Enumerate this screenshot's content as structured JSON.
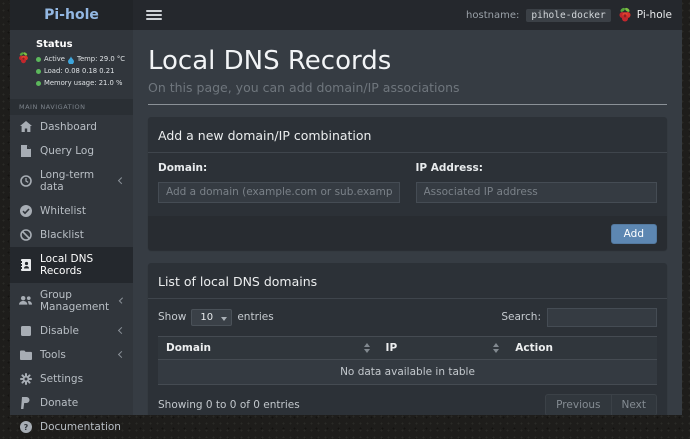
{
  "colors": {
    "brand_text": "#93b8e3",
    "status_green": "#5cb85c",
    "add_button": "#5d87b2",
    "content_bg": "#363c43",
    "card_bg": "#2c3137",
    "sidebar_bg": "#31363c"
  },
  "header": {
    "brand": "Pi-hole",
    "hostname_label": "hostname:",
    "hostname_value": "pihole-docker",
    "account_label": "Pi-hole"
  },
  "sidebar": {
    "status": {
      "title": "Status",
      "active_label": "Active",
      "temp": "Temp: 29.0 °C",
      "load": "Load: 0.08 0.18 0.21",
      "memory": "Memory usage: 21.0 %"
    },
    "nav_header": "MAIN NAVIGATION",
    "items": [
      {
        "label": "Dashboard"
      },
      {
        "label": "Query Log"
      },
      {
        "label": "Long-term data",
        "submenu": true
      },
      {
        "label": "Whitelist"
      },
      {
        "label": "Blacklist"
      },
      {
        "label": "Local DNS Records",
        "active": true
      },
      {
        "label": "Group Management",
        "submenu": true
      },
      {
        "label": "Disable",
        "submenu": true
      },
      {
        "label": "Tools",
        "submenu": true
      },
      {
        "label": "Settings"
      },
      {
        "label": "Donate"
      },
      {
        "label": "Documentation"
      }
    ]
  },
  "page": {
    "title": "Local DNS Records",
    "subtitle": "On this page, you can add domain/IP associations"
  },
  "add_card": {
    "title": "Add a new domain/IP combination",
    "domain_label": "Domain:",
    "domain_placeholder": "Add a domain (example.com or sub.example.com)",
    "ip_label": "IP Address:",
    "ip_placeholder": "Associated IP address",
    "add_button": "Add"
  },
  "list_card": {
    "title": "List of local DNS domains",
    "show_label": "Show",
    "page_size": "10",
    "entries_label": "entries",
    "search_label": "Search:",
    "columns": [
      "Domain",
      "IP",
      "Action"
    ],
    "empty_text": "No data available in table",
    "summary": "Showing 0 to 0 of 0 entries",
    "previous_label": "Previous",
    "next_label": "Next"
  }
}
